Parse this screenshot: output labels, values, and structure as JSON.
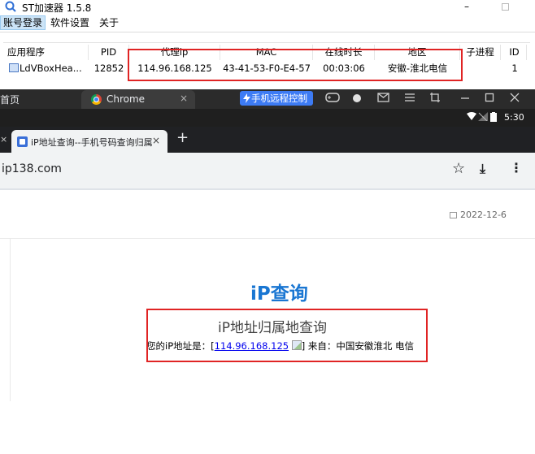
{
  "st_app": {
    "title": "ST加速器 1.5.8",
    "min_glyph": "–",
    "menu": [
      "账号登录",
      "软件设置",
      "关于"
    ],
    "table": {
      "headers": [
        "应用程序",
        "PID",
        "代理ip",
        "MAC",
        "在线时长",
        "地区",
        "子进程",
        "ID"
      ],
      "rows": [
        [
          "LdVBoxHea...",
          "12852",
          "114.96.168.125",
          "43-41-53-F0-E4-57",
          "00:03:06",
          "安徽-淮北电信",
          "",
          "1"
        ]
      ]
    }
  },
  "chrome": {
    "left_tab": "首页",
    "tab_label": "Chrome",
    "tab_close": "×",
    "remote_button": "手机远程控制",
    "toolbar_icons": [
      "gamepad-icon",
      "circle-icon",
      "mail-icon",
      "hamburger-icon",
      "crop-icon",
      "minimize-icon",
      "maximize-icon",
      "close-icon"
    ]
  },
  "android": {
    "status_time": "5:30"
  },
  "mobile_browser": {
    "tab_left_x": "×",
    "tab_title": "iP地址查询--手机号码查询归属",
    "tab_close": "×",
    "new_tab": "+",
    "url": "ip138.com",
    "star": "☆",
    "download": "⤓",
    "menu": "⋮"
  },
  "page": {
    "date": "2022-12-6",
    "logo_prefix": "iP",
    "logo_suffix": "查询",
    "heading": "iP地址归属地查询",
    "ip_prefix": "您的iP地址是：[",
    "ip_value": "114.96.168.125",
    "ip_suffix": "] 来自：中国安徽淮北 电信"
  },
  "colors": {
    "highlight": "#e02424",
    "remote_button": "#3d7bf4",
    "logo_blue": "#1976d2"
  }
}
